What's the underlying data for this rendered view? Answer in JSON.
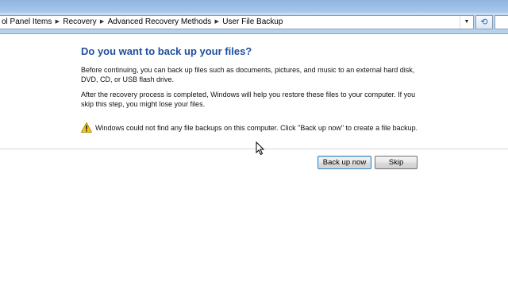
{
  "address_bar": {
    "crumbs": [
      "ol Panel Items",
      "Recovery",
      "Advanced Recovery Methods",
      "User File Backup"
    ],
    "separator_icon": "chevron-right-icon",
    "dropdown_icon": "chevron-down-icon",
    "refresh_icon": "refresh-icon"
  },
  "content": {
    "heading": "Do you want to back up your files?",
    "paragraph1": "Before continuing, you can back up files such as documents, pictures, and music to an external hard disk, DVD, CD, or USB flash drive.",
    "paragraph2": "After the recovery process is completed, Windows will help you restore these files to  your computer.  If you skip this step, you might lose your files.",
    "warning": {
      "icon": "warning-icon",
      "text": "Windows could not find any file backups on this computer. Click \"Back up now\" to create a file backup."
    }
  },
  "buttons": {
    "back_up_now": "Back up now",
    "skip": "Skip"
  },
  "colors": {
    "heading": "#1e4fa0",
    "title_bar": "#a9c9ec",
    "warning_fill": "#f5c518"
  }
}
